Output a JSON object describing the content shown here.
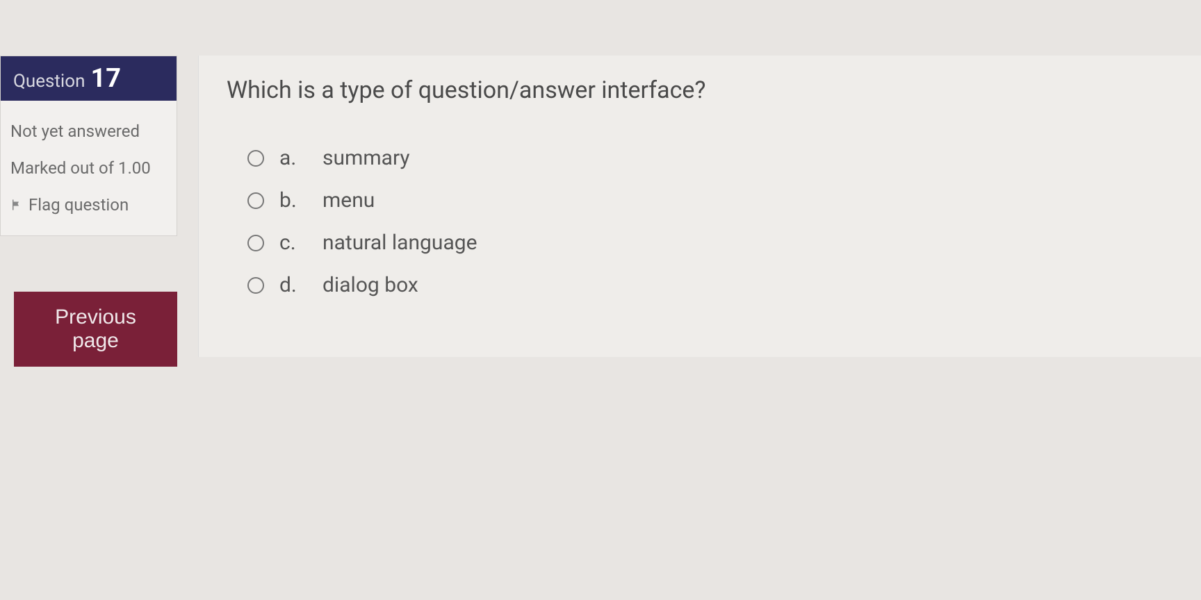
{
  "sidebar": {
    "question_label": "Question",
    "question_number": "17",
    "status": "Not yet answered",
    "marked": "Marked out of 1.00",
    "flag_label": "Flag question"
  },
  "question": {
    "text": "Which is a type of question/answer interface?",
    "options": [
      {
        "letter": "a.",
        "text": "summary"
      },
      {
        "letter": "b.",
        "text": "menu"
      },
      {
        "letter": "c.",
        "text": "natural language"
      },
      {
        "letter": "d.",
        "text": "dialog box"
      }
    ]
  },
  "nav": {
    "previous": "Previous page"
  }
}
